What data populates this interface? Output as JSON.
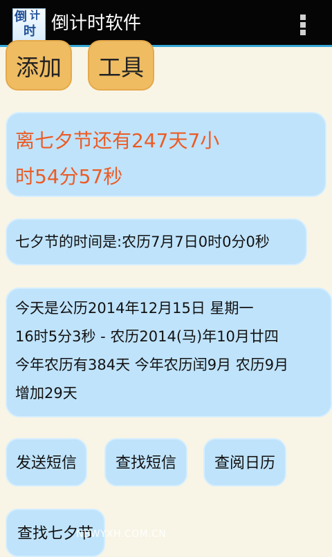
{
  "app": {
    "title": "倒计时软件",
    "icon_chars": [
      "倒",
      "计",
      "时"
    ]
  },
  "toolbar": {
    "add_label": "添加",
    "tools_label": "工具"
  },
  "countdown": {
    "line1": "离七夕节还有247天7小",
    "line2": "时54分57秒",
    "color": "#ec5b24"
  },
  "target": {
    "text": "七夕节的时间是:农历7月7日0时0分0秒"
  },
  "today": {
    "lines": [
      "今天是公历2014年12月15日 星期一",
      "16时5分3秒 - 农历2014(马)年10月廿四",
      "今年农历有384天 今年农历闰9月 农历9月",
      "增加29天"
    ]
  },
  "actions": {
    "send_sms": "发送短信",
    "find_sms": "查找短信",
    "view_calendar": "查阅日历",
    "find_qixi": "查找七夕节"
  },
  "watermark": "NBWYXH.COM.CN",
  "colors": {
    "titlebar": "#050505",
    "accent": "#35a7d8",
    "orange_button": "#efbc62",
    "card": "#bfe3fb",
    "background": "#f8f5e6"
  },
  "icons": {
    "app_icon": "countdown-app-icon",
    "menu": "overflow-menu-icon"
  }
}
